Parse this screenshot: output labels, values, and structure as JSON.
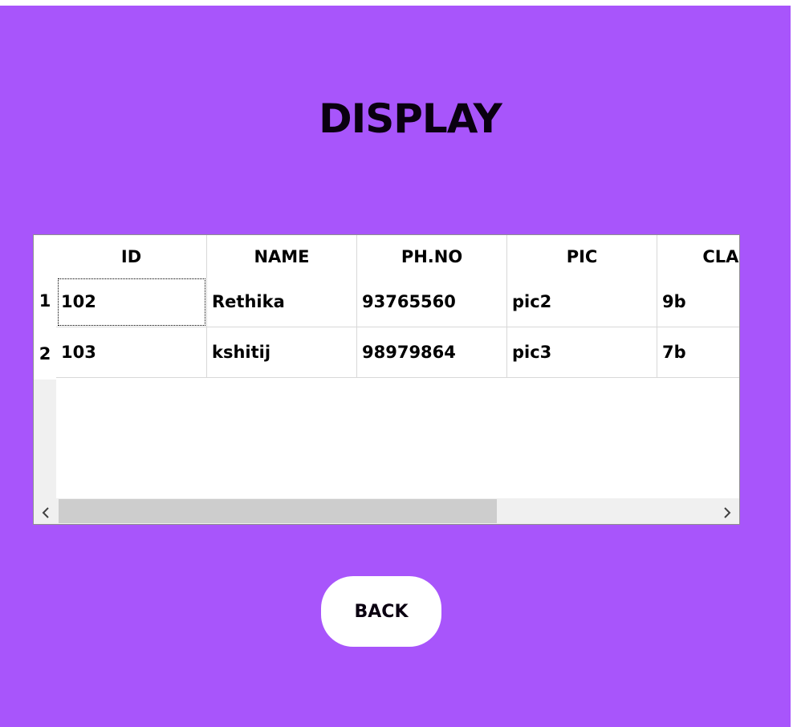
{
  "page": {
    "title": "DISPLAY"
  },
  "table": {
    "columns": [
      "ID",
      "NAME",
      "PH.NO",
      "PIC",
      "CLASS"
    ],
    "rows": [
      {
        "num": "1",
        "cells": [
          "102",
          "Rethika",
          "93765560",
          "pic2",
          "9b"
        ]
      },
      {
        "num": "2",
        "cells": [
          "103",
          "kshitij",
          "98979864",
          "pic3",
          "7b"
        ]
      }
    ],
    "scroll_left_icon": "chevron-left-icon",
    "scroll_right_icon": "chevron-right-icon"
  },
  "back_button": {
    "label": "BACK"
  },
  "colors": {
    "background": "#a855fb",
    "button": "#ffffff"
  }
}
